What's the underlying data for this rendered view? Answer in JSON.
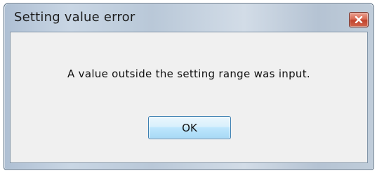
{
  "dialog": {
    "title": "Setting value error",
    "message": "A value outside the setting range was input.",
    "ok_label": "OK",
    "close_icon": "close-x"
  },
  "colors": {
    "client_background": "#f0f0f0",
    "close_button": "#c9553f",
    "ok_button_border": "#3c7fb1"
  }
}
